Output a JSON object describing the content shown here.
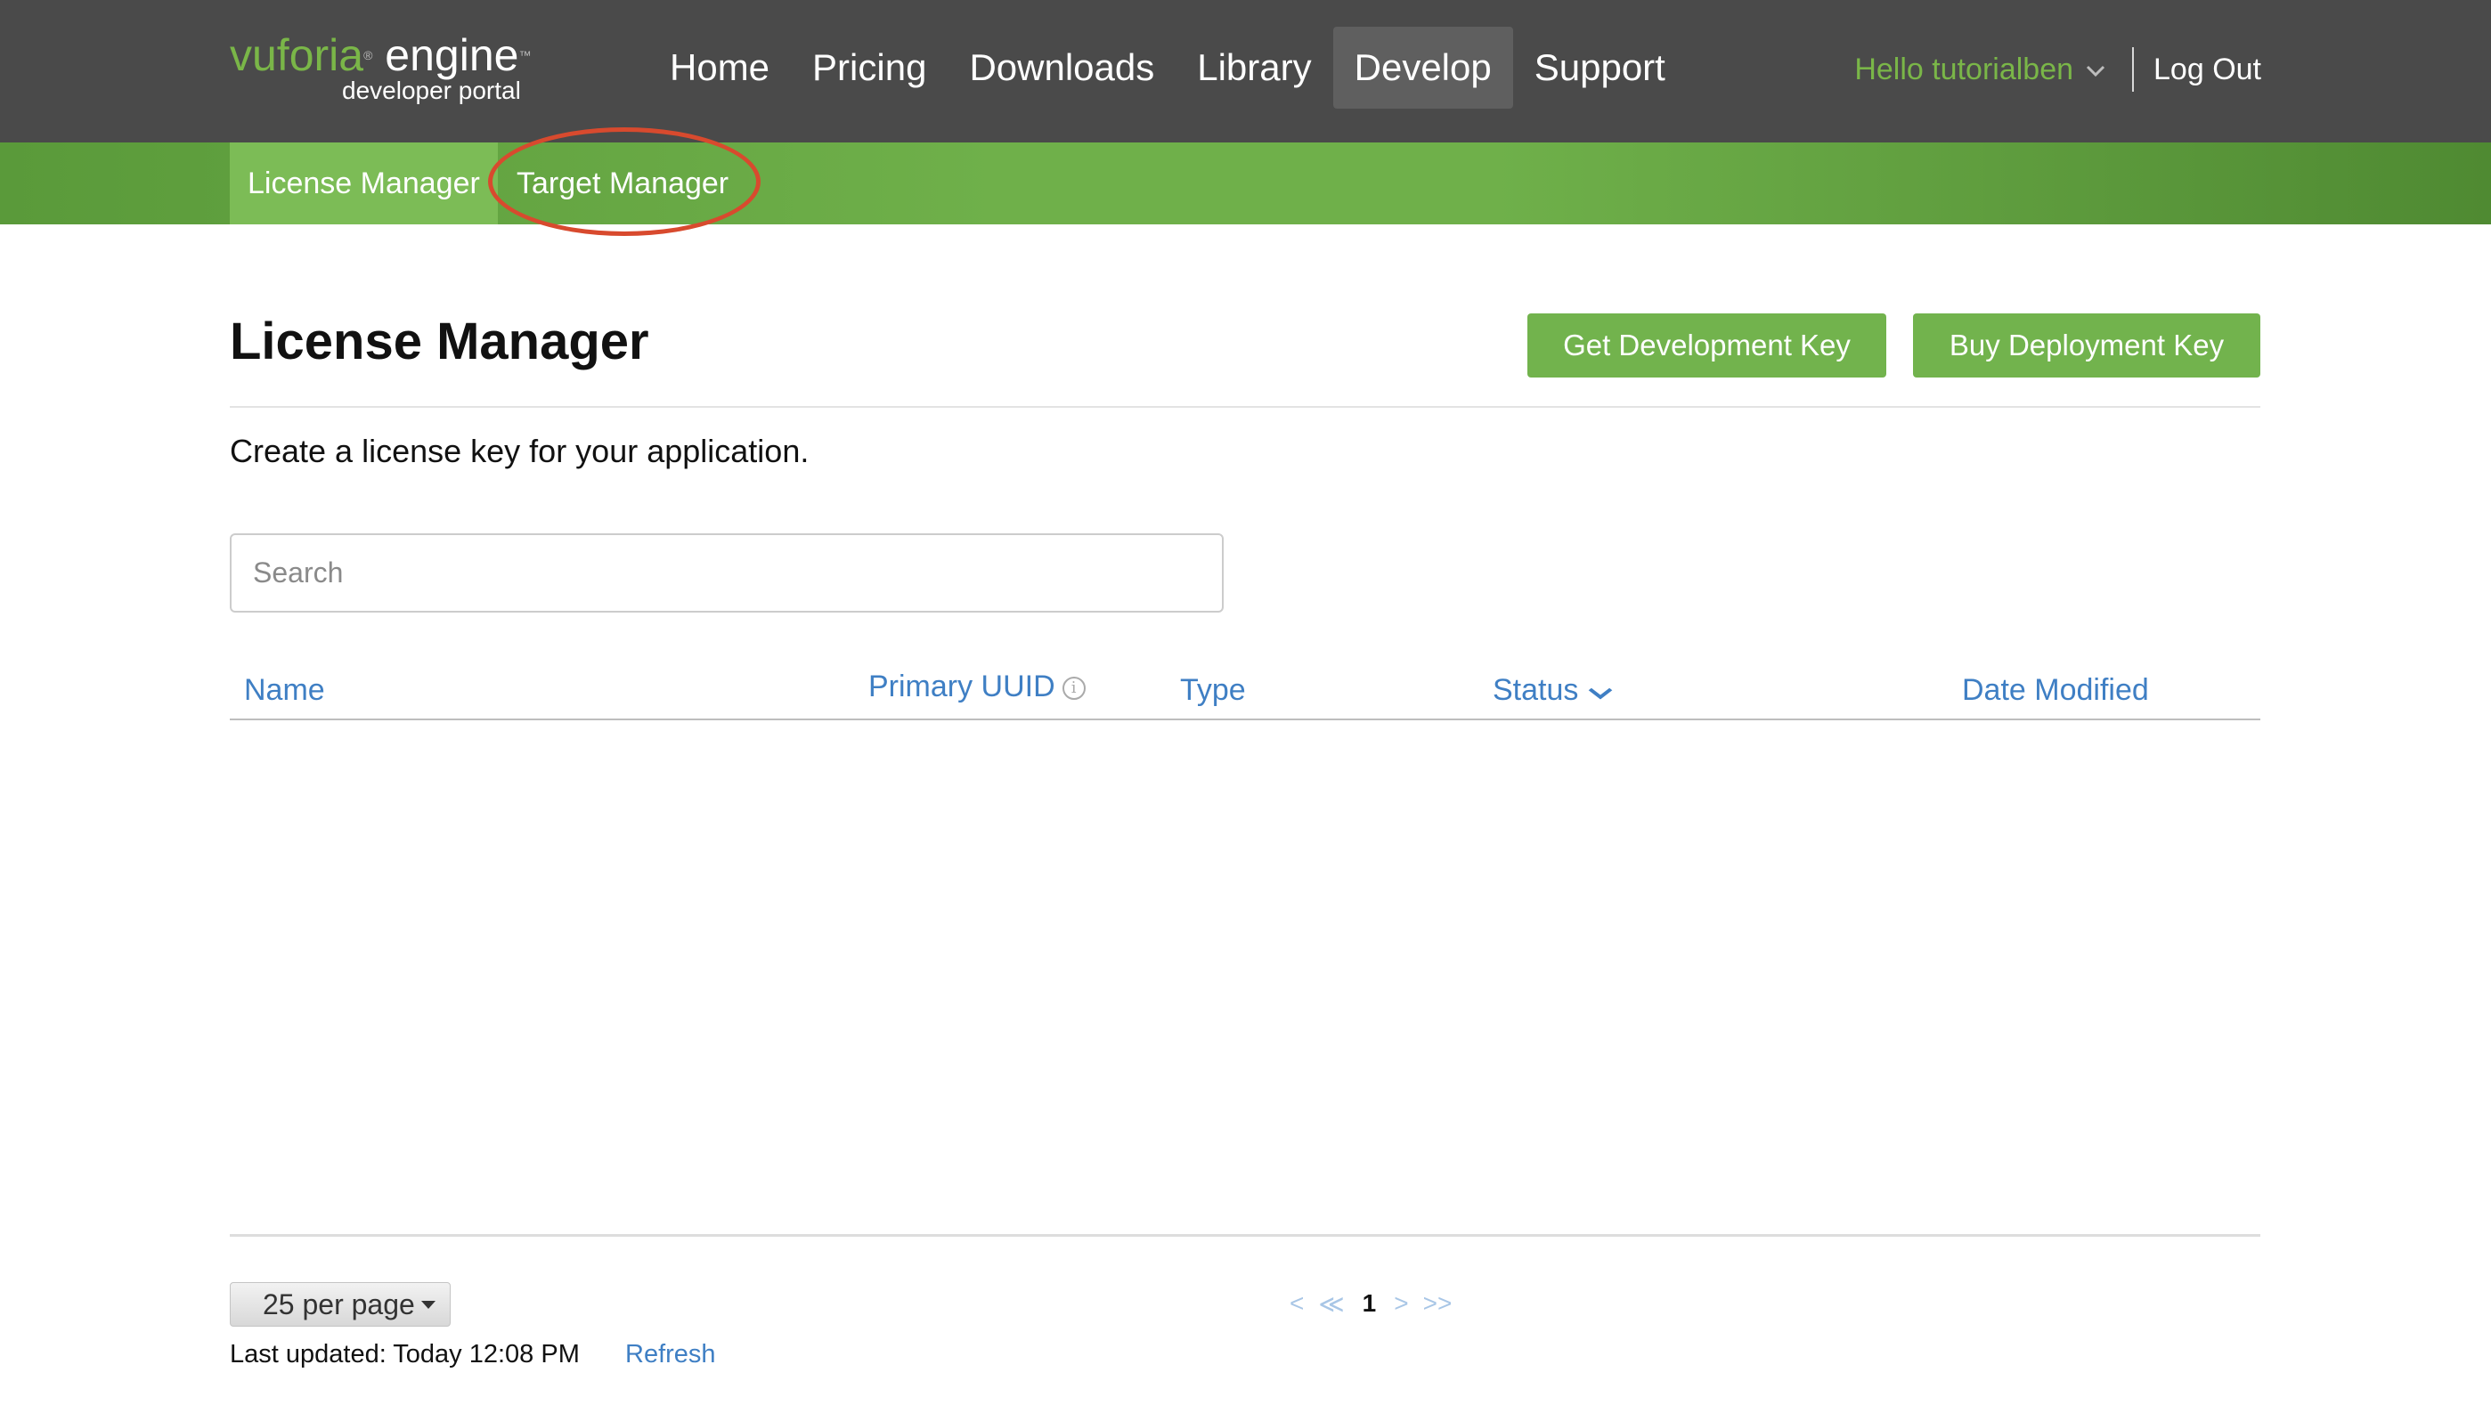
{
  "header": {
    "logo_vuforia": "vuforia",
    "logo_engine": " engine",
    "logo_sub": "developer portal",
    "nav": [
      "Home",
      "Pricing",
      "Downloads",
      "Library",
      "Develop",
      "Support"
    ],
    "active_nav": "Develop",
    "greeting": "Hello tutorialben",
    "logout": "Log Out"
  },
  "subnav": {
    "license_manager": "License Manager",
    "target_manager": "Target Manager"
  },
  "main": {
    "title": "License Manager",
    "get_dev_key": "Get Development Key",
    "buy_deploy_key": "Buy Deployment Key",
    "subtitle": "Create a license key for your application.",
    "search_placeholder": "Search"
  },
  "table": {
    "columns": {
      "name": "Name",
      "uuid": "Primary UUID",
      "type": "Type",
      "status": "Status",
      "date": "Date Modified"
    },
    "rows": []
  },
  "footer": {
    "per_page": "25 per page",
    "last_updated": "Last updated: Today 12:08 PM",
    "refresh": "Refresh",
    "pager": {
      "first": "<",
      "prev": "≪",
      "current": "1",
      "next": ">",
      "last": ">>"
    }
  },
  "colors": {
    "accent_green": "#72b34d",
    "link_blue": "#3f7fc4",
    "header_bg": "#4a4a4a",
    "highlight_circle": "#d84a2e"
  },
  "icons": {
    "info": "info-icon",
    "sort": "chevron-down-icon",
    "user_menu": "chevron-down-icon",
    "per_page_caret": "caret-down-icon"
  }
}
